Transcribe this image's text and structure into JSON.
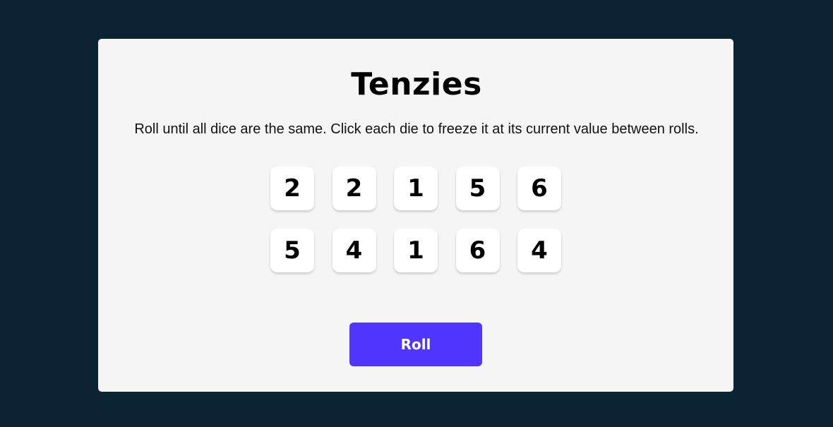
{
  "game": {
    "title": "Tenzies",
    "instructions": "Roll until all dice are the same. Click each die to freeze it at its current value between rolls.",
    "dice": [
      2,
      2,
      1,
      5,
      6,
      5,
      4,
      1,
      6,
      4
    ],
    "roll_label": "Roll"
  },
  "colors": {
    "background": "#0b2434",
    "card": "#f5f5f5",
    "die": "#ffffff",
    "button": "#5035ff",
    "button_text": "#ffffff"
  }
}
